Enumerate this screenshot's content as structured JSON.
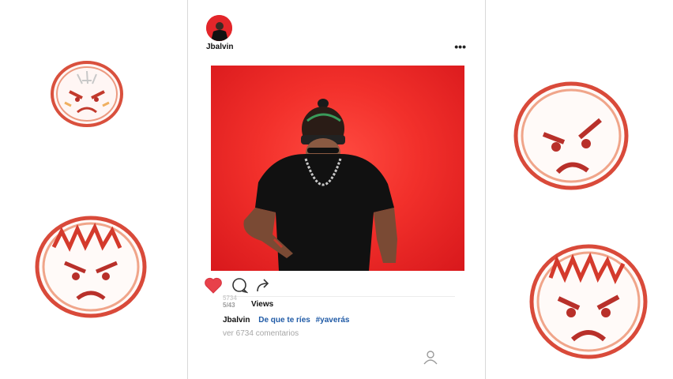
{
  "post": {
    "username": "Jbalvin",
    "views_number": "5/43",
    "views_number_ghost": "5734",
    "views_label": "Views",
    "caption_user": "Jbalvin",
    "caption_text": "De que te ríes",
    "caption_hashtag": "#yaverás",
    "comments_link": "ver 6734 comentarios",
    "liked": true
  },
  "colors": {
    "photo_background": "#ef2d2a",
    "heart": "#e8414a",
    "link_blue": "#1f5aa6",
    "doodle_red": "#d94a3a"
  },
  "icons": [
    "more-options-icon",
    "heart-icon",
    "comment-icon",
    "share-icon",
    "user-profile-icon",
    "angry-face-doodle"
  ]
}
